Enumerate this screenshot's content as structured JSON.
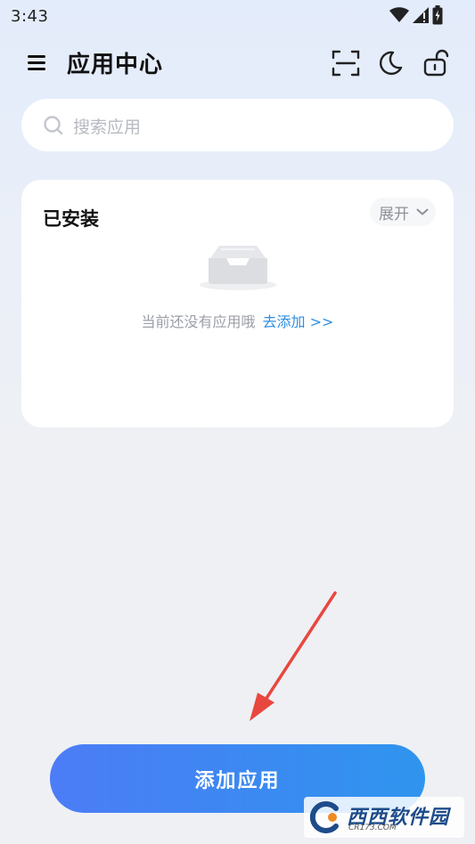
{
  "status_bar": {
    "time": "3:43"
  },
  "header": {
    "title": "应用中心",
    "icons": [
      "menu-icon",
      "scan-icon",
      "moon-icon",
      "unlock-icon"
    ]
  },
  "search": {
    "placeholder": "搜索应用"
  },
  "installed": {
    "title": "已安装",
    "expand_label": "展开",
    "empty_text": "当前还没有应用哦",
    "add_link": "去添加 >>"
  },
  "add_button": {
    "label": "添加应用"
  },
  "watermark": {
    "name": "西西软件园",
    "url": "CR173.COM"
  },
  "colors": {
    "accent": "#2f8fe0",
    "button_start": "#4c7cf6",
    "button_end": "#2f95ee",
    "arrow": "#e8473f"
  }
}
